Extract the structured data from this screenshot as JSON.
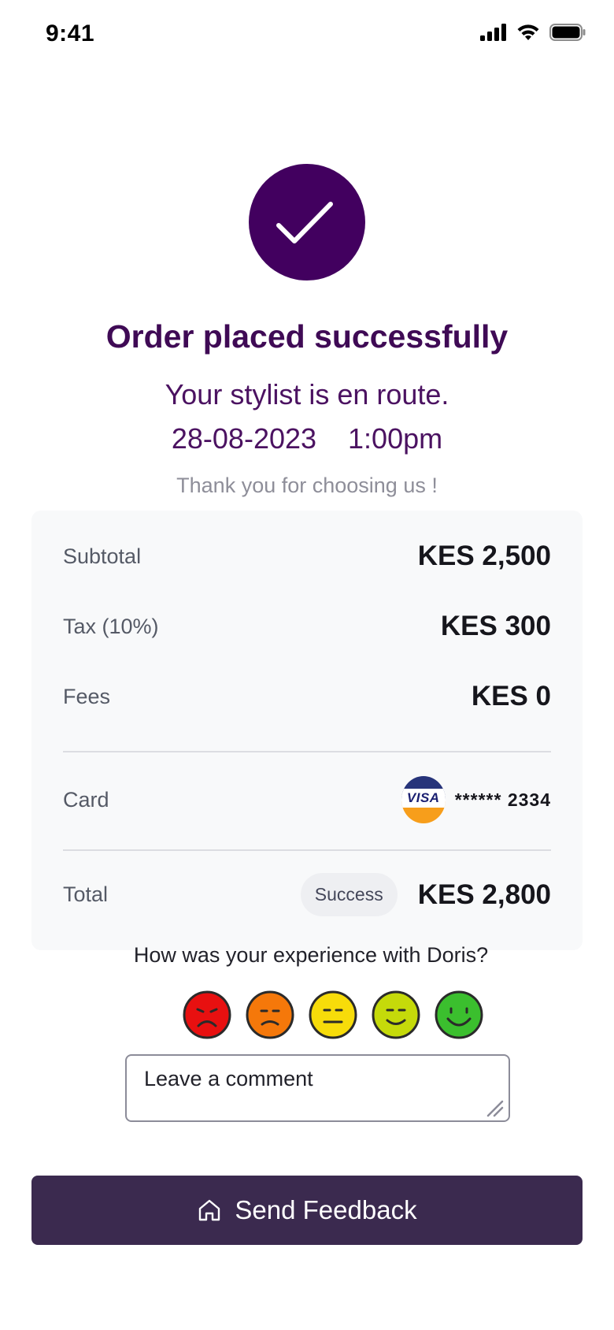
{
  "status_bar": {
    "time": "9:41",
    "icons": [
      "signal-icon",
      "wifi-icon",
      "battery-icon"
    ]
  },
  "header": {
    "success_icon": "checkmark-icon",
    "title": "Order placed successfully",
    "subtitle": "Your stylist is en route.",
    "date": "28-08-2023",
    "time": "1:00pm",
    "thanks": "Thank you for choosing us !"
  },
  "summary": {
    "subtotal_label": "Subtotal",
    "subtotal_value": "KES 2,500",
    "tax_label": "Tax (10%)",
    "tax_value": "KES 300",
    "fees_label": "Fees",
    "fees_value": "KES 0",
    "card_label": "Card",
    "card_brand": "VISA",
    "card_number": "****** 2334",
    "total_label": "Total",
    "status_badge": "Success",
    "total_value": "KES 2,800"
  },
  "rating": {
    "question": "How was your experience with Doris?",
    "faces": [
      {
        "name": "very-sad-face-icon",
        "color": "#e81010"
      },
      {
        "name": "sad-face-icon",
        "color": "#f5780a"
      },
      {
        "name": "neutral-face-icon",
        "color": "#f7dc0a"
      },
      {
        "name": "happy-face-icon",
        "color": "#c5da0a"
      },
      {
        "name": "very-happy-face-icon",
        "color": "#3bbf2e"
      }
    ]
  },
  "comment": {
    "placeholder": "Leave a comment"
  },
  "action": {
    "button_label": "Send Feedback",
    "button_icon": "home-icon"
  },
  "colors": {
    "brand_purple": "#42005f",
    "button_bg": "#3b2a4f",
    "card_bg": "#f8f9fa"
  }
}
